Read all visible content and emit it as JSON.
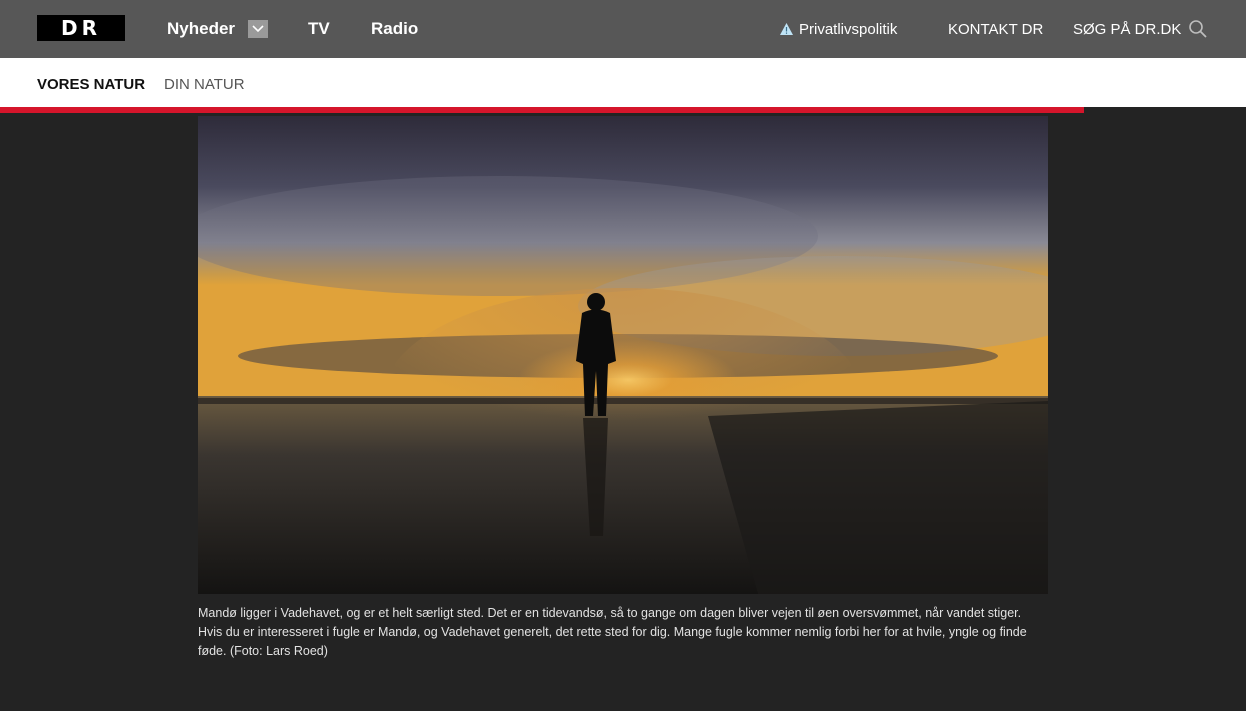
{
  "header": {
    "logo_text": "DR",
    "nav": [
      {
        "label": "Nyheder",
        "has_dropdown": true
      },
      {
        "label": "TV"
      },
      {
        "label": "Radio"
      }
    ],
    "privacy_label": "Privatlivspolitik",
    "contact_label": "KONTAKT DR",
    "search_label": "SØG PÅ DR.DK",
    "privacy_icon": "warning-triangle-icon",
    "search_icon": "search-icon"
  },
  "subnav": {
    "tabs": [
      {
        "label": "VORES NATUR",
        "active": true
      },
      {
        "label": "DIN NATUR",
        "active": false
      }
    ]
  },
  "progress": {
    "percent": 87,
    "color": "#d5152b"
  },
  "article": {
    "caption": "Mandø ligger i Vadehavet, og er et helt særligt sted. Det er en tidevandsø, så to gange om dagen bliver vejen til øen oversvømmet, når vandet stiger. Hvis du er interesseret i fugle er Mandø, og Vadehavet generelt, det rette sted for dig. Mange fugle kommer nemlig forbi her for at hvile, yngle og finde føde. (Foto: Lars Roed)"
  },
  "colors": {
    "header_bg": "#575757",
    "page_bg": "#232323",
    "accent": "#d5152b"
  }
}
